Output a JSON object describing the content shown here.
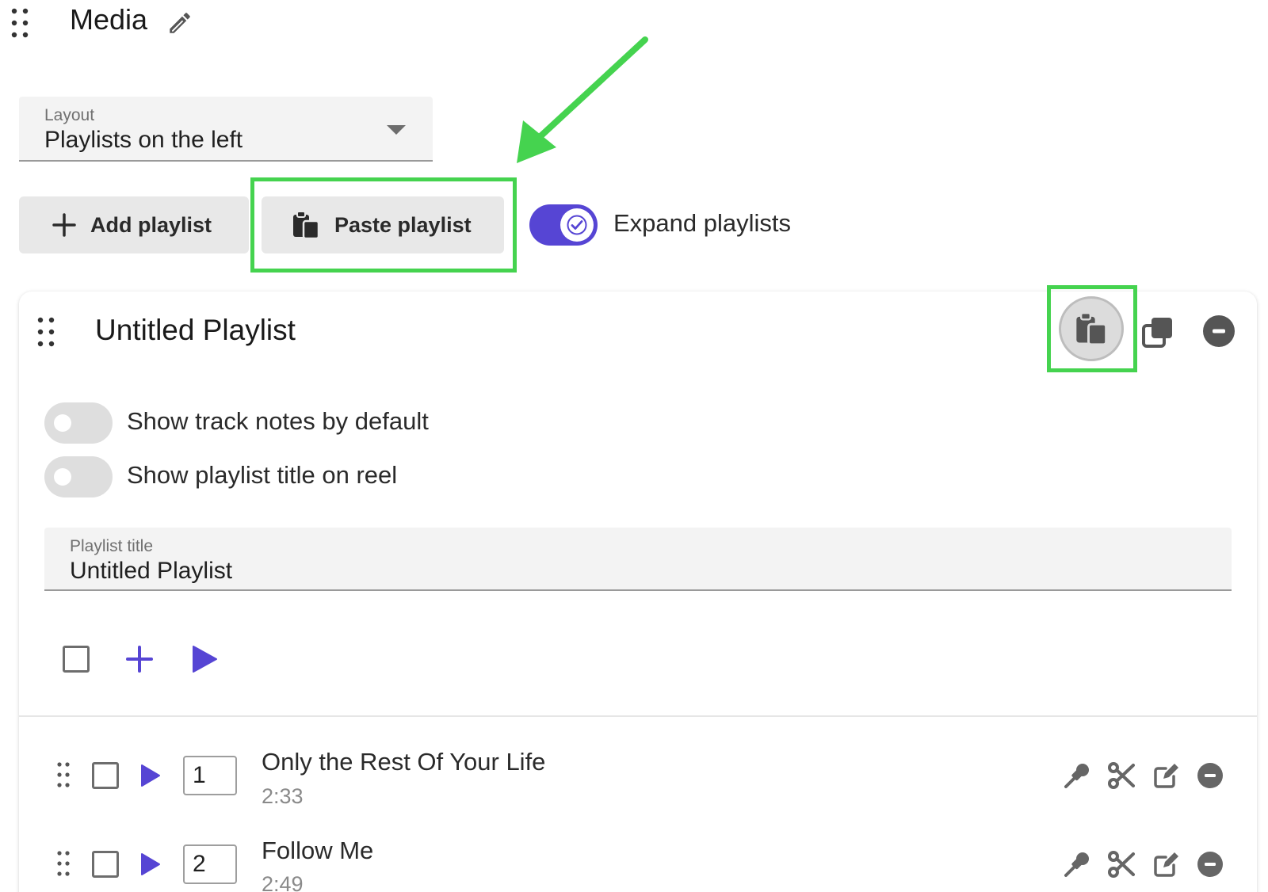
{
  "section": {
    "title": "Media"
  },
  "layout_select": {
    "label": "Layout",
    "value": "Playlists on the left"
  },
  "buttons": {
    "add_playlist": "Add playlist",
    "paste_playlist": "Paste playlist"
  },
  "expand_toggle": {
    "label": "Expand playlists",
    "checked": true
  },
  "playlist": {
    "title": "Untitled Playlist",
    "options": [
      {
        "label": "Show track notes by default",
        "checked": false
      },
      {
        "label": "Show playlist title on reel",
        "checked": false
      }
    ],
    "title_field": {
      "label": "Playlist title",
      "value": "Untitled Playlist"
    },
    "tracks": [
      {
        "number": "1",
        "title": "Only the Rest Of Your Life",
        "duration": "2:33"
      },
      {
        "number": "2",
        "title": "Follow Me",
        "duration": "2:49"
      }
    ]
  },
  "colors": {
    "accent": "#5645d4",
    "highlight": "#45d34f",
    "icon_gray": "#666666"
  }
}
